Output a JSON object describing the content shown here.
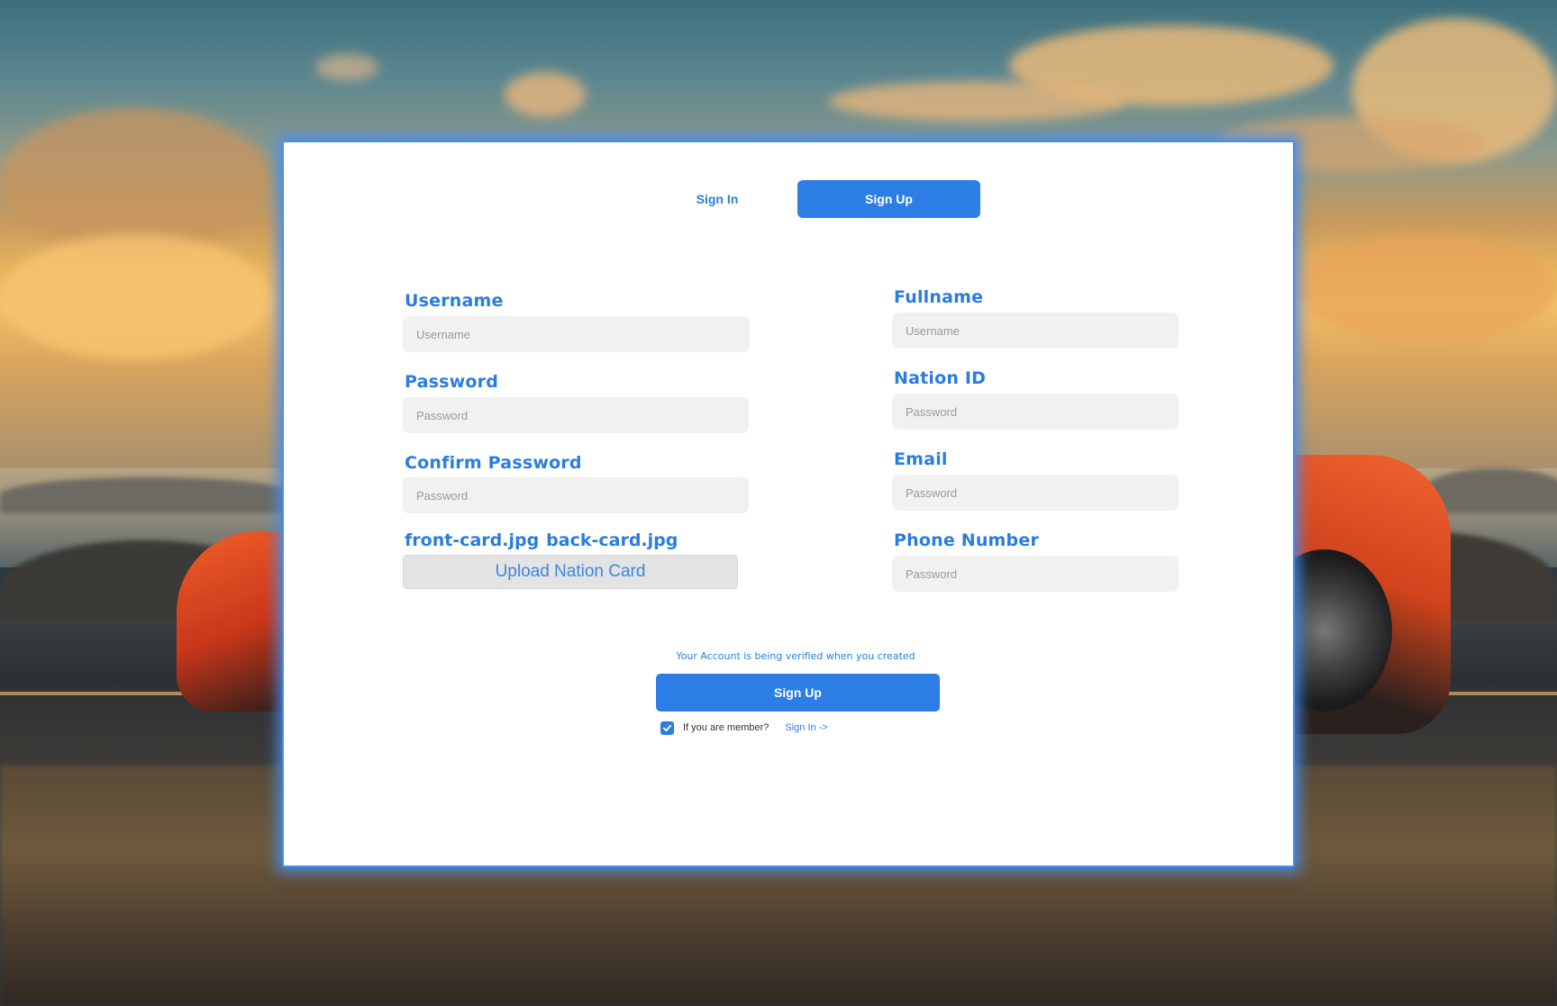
{
  "tabs": {
    "signin_label": "Sign In",
    "signup_label": "Sign Up"
  },
  "left_fields": [
    {
      "label": "Username",
      "placeholder": "Username"
    },
    {
      "label": "Password",
      "placeholder": "Password"
    },
    {
      "label": "Confirm Password",
      "placeholder": "Password"
    }
  ],
  "right_fields": [
    {
      "label": "Fullname",
      "placeholder": "Username"
    },
    {
      "label": "Nation ID",
      "placeholder": "Password"
    },
    {
      "label": "Email",
      "placeholder": "Password"
    },
    {
      "label": "Phone Number",
      "placeholder": "Password"
    }
  ],
  "upload": {
    "files": [
      "front-card.jpg",
      "back-card.jpg"
    ],
    "button_label": "Upload Nation Card"
  },
  "verify_note": "Your Account is being verified when you created",
  "submit_label": "Sign Up",
  "member": {
    "checked": true,
    "text": "If you are member?",
    "link": "Sign In ->"
  },
  "colors": {
    "accent": "#2d7de6",
    "text_blue": "#2a7de0",
    "input_bg": "#f1f1f1",
    "upload_bg": "#e3e3e3"
  },
  "icons": {
    "checkbox": "check-icon"
  }
}
